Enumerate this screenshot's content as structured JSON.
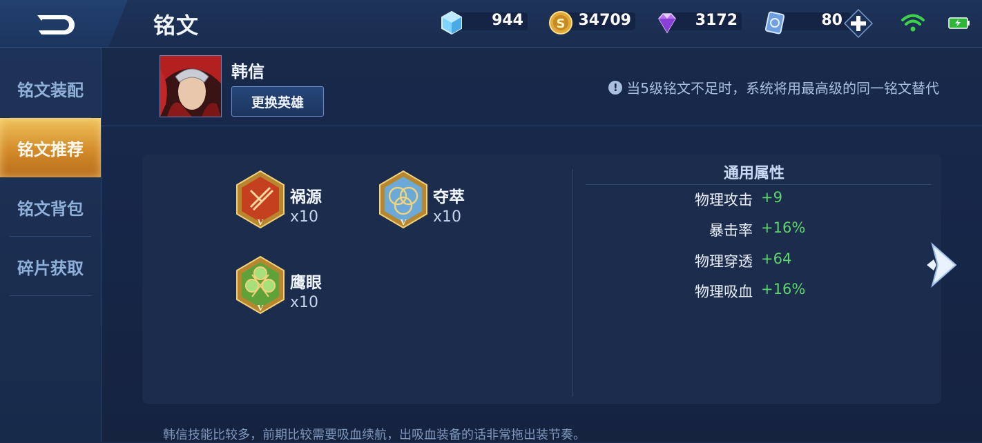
{
  "header": {
    "title": "铭文"
  },
  "currencies": [
    {
      "name": "coupon",
      "icon": "crystal-cube-icon",
      "value": "944"
    },
    {
      "name": "gold",
      "icon": "gold-coin-icon",
      "value": "34709"
    },
    {
      "name": "diamond",
      "icon": "purple-diamond-icon",
      "value": "3172"
    },
    {
      "name": "card",
      "icon": "card-icon",
      "value": "80"
    }
  ],
  "sidebar": {
    "items": [
      {
        "label": "铭文装配",
        "active": false
      },
      {
        "label": "铭文推荐",
        "active": true
      },
      {
        "label": "铭文背包",
        "active": false
      },
      {
        "label": "碎片获取",
        "active": false
      }
    ]
  },
  "hero": {
    "name": "韩信",
    "change_button": "更换英雄",
    "notice": "当5级铭文不足时，系统将用最高级的同一铭文替代"
  },
  "runes": [
    {
      "name": "祸源",
      "count": "x10",
      "color": "red",
      "level": "V"
    },
    {
      "name": "夺萃",
      "count": "x10",
      "color": "blue",
      "level": "V"
    },
    {
      "name": "鹰眼",
      "count": "x10",
      "color": "green",
      "level": "V"
    }
  ],
  "attributes": {
    "title": "通用属性",
    "rows": [
      {
        "label": "物理攻击",
        "value": "+9"
      },
      {
        "label": "暴击率",
        "value": "+16%"
      },
      {
        "label": "物理穿透",
        "value": "+64"
      },
      {
        "label": "物理吸血",
        "value": "+16%"
      }
    ]
  },
  "description": "韩信技能比较多，前期比较需要吸血续航，出吸血装备的话非常拖出装节奏。",
  "colors": {
    "accent_gold": "#d69a38",
    "positive_green": "#5fd66b",
    "bg_navy": "#17274a"
  }
}
